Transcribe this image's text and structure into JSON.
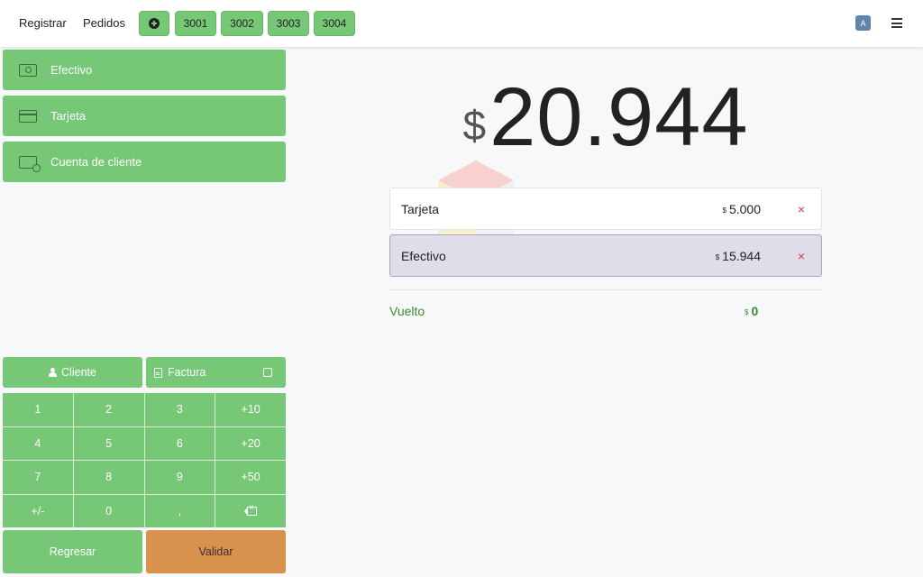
{
  "topbar": {
    "nav_register": "Registrar",
    "nav_orders": "Pedidos",
    "add_order_icon": "plus-circle-icon",
    "orders": [
      "3001",
      "3002",
      "3003",
      "3004"
    ],
    "avatar_initial": "A",
    "menu_icon": "hamburger-menu-icon"
  },
  "payment_methods": [
    {
      "label": "Efectivo",
      "icon": "cash-icon"
    },
    {
      "label": "Tarjeta",
      "icon": "credit-card-icon"
    },
    {
      "label": "Cuenta de cliente",
      "icon": "customer-account-icon"
    }
  ],
  "actions": {
    "customer_label": "Cliente",
    "invoice_label": "Factura"
  },
  "numpad": {
    "keys": [
      "1",
      "2",
      "3",
      "+10",
      "4",
      "5",
      "6",
      "+20",
      "7",
      "8",
      "9",
      "+50",
      "+/-",
      "0",
      ",",
      ""
    ],
    "backspace_icon": "backspace-icon"
  },
  "footer": {
    "back_label": "Regresar",
    "validate_label": "Validar"
  },
  "summary": {
    "currency": "$",
    "total": "20.944",
    "lines": [
      {
        "name": "Tarjeta",
        "currency": "$",
        "amount": "5.000",
        "delete": "×"
      },
      {
        "name": "Efectivo",
        "currency": "$",
        "amount": "15.944",
        "delete": "×"
      }
    ],
    "change_label": "Vuelto",
    "change_currency": "$",
    "change_amount": "0"
  },
  "colors": {
    "accent_green": "#76c776",
    "validate_orange": "#d9924e",
    "selected_line": "#dfdde9",
    "delete_red": "#d23c3c",
    "change_green": "#3d8a2c"
  }
}
